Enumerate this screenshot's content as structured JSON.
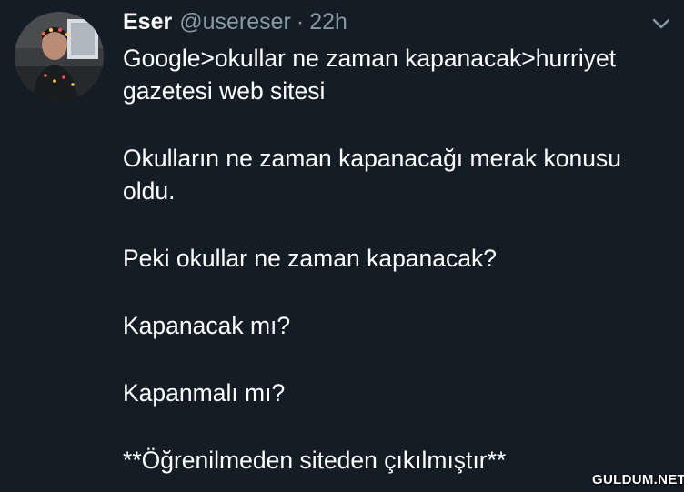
{
  "tweet": {
    "author_name": "Eser",
    "author_handle": "@usereser",
    "separator": "·",
    "timestamp": "22h",
    "lines": {
      "l1": "Google>okullar ne zaman kapanacak>hurriyet",
      "l2": "gazetesi web sitesi",
      "l3": "Okulların ne zaman kapanacağı merak konusu",
      "l4": "oldu.",
      "l5": "Peki okullar ne zaman kapanacak?",
      "l6": "Kapanacak mı?",
      "l7": "Kapanmalı mı?",
      "l8": "**Öğrenilmeden siteden çıkılmıştır**"
    },
    "menu_icon": "chevron-down-icon"
  },
  "watermark": "GULDUM.NET",
  "colors": {
    "background": "#141d26",
    "text": "#ffffff",
    "secondary_text": "#8899a6"
  }
}
